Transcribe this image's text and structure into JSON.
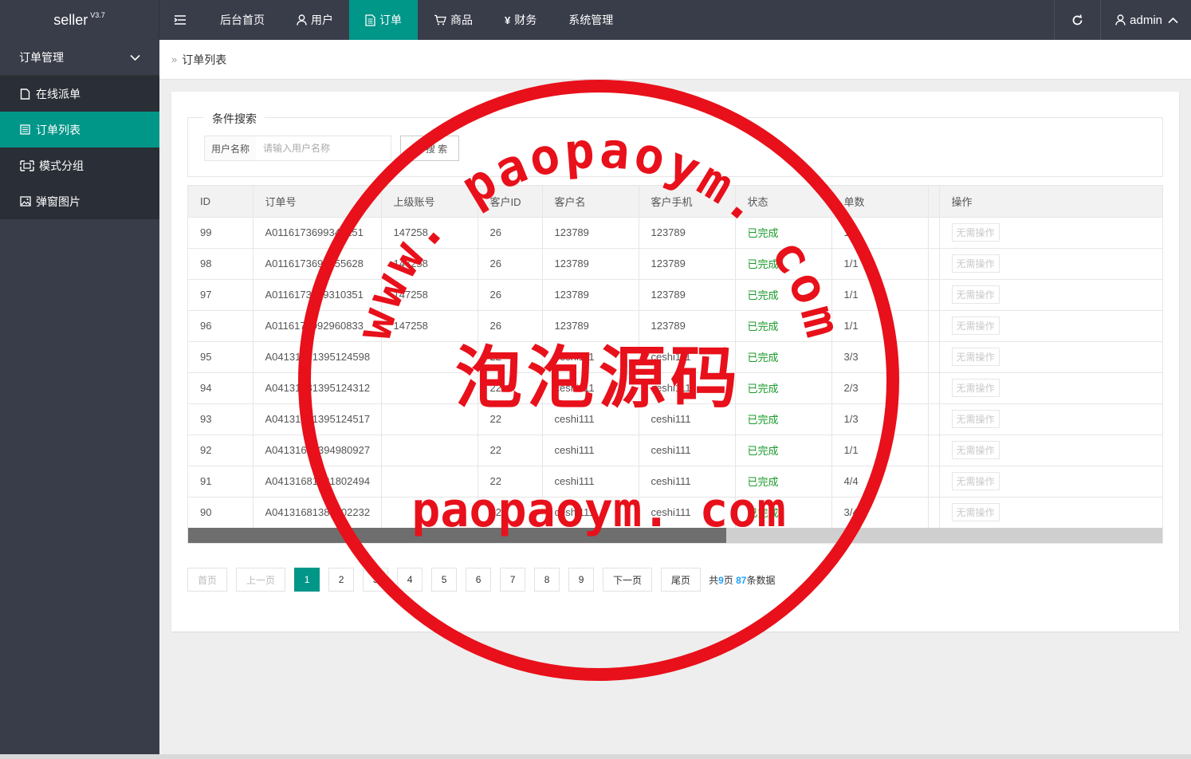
{
  "app": {
    "logo": "seller",
    "version": "V3.7"
  },
  "nav": {
    "items": [
      {
        "label": "后台首页",
        "icon": "",
        "active": false
      },
      {
        "label": "用户",
        "icon": "user-icon",
        "active": false
      },
      {
        "label": "订单",
        "icon": "document-icon",
        "active": true
      },
      {
        "label": "商品",
        "icon": "cart-icon",
        "active": false
      },
      {
        "label": "财务",
        "icon": "yen-icon",
        "active": false
      },
      {
        "label": "系统管理",
        "icon": "",
        "active": false
      }
    ],
    "user": "admin"
  },
  "sidebar": {
    "group": "订单管理",
    "items": [
      {
        "label": "在线派单",
        "icon": "file-icon",
        "active": false
      },
      {
        "label": "订单列表",
        "icon": "list-icon",
        "active": true
      },
      {
        "label": "模式分组",
        "icon": "group-icon",
        "active": false
      },
      {
        "label": "弹窗图片",
        "icon": "image-icon",
        "active": false
      }
    ]
  },
  "breadcrumb": {
    "sep": "»",
    "current": "订单列表"
  },
  "search": {
    "legend": "条件搜索",
    "label": "用户名称",
    "placeholder": "请输入用户名称",
    "value": "",
    "button": "搜 索"
  },
  "table": {
    "headers": [
      "ID",
      "订单号",
      "上级账号",
      "客户ID",
      "客户名",
      "客户手机",
      "状态",
      "单数",
      "",
      "操作"
    ],
    "rows": [
      [
        "99",
        "A0116173699340151",
        "147258",
        "26",
        "123789",
        "123789",
        "已完成",
        "1/1",
        "",
        "无需操作"
      ],
      [
        "98",
        "A0116173693155628",
        "147258",
        "26",
        "123789",
        "123789",
        "已完成",
        "1/1",
        "",
        "无需操作"
      ],
      [
        "97",
        "A0116173699310351",
        "147258",
        "26",
        "123789",
        "123789",
        "已完成",
        "1/1",
        "",
        "无需操作"
      ],
      [
        "96",
        "A0116175992960833",
        "147258",
        "26",
        "123789",
        "123789",
        "已完成",
        "1/1",
        "",
        "无需操作"
      ],
      [
        "95",
        "A04131681395124598",
        "",
        "22",
        "ceshi111",
        "ceshi111",
        "已完成",
        "3/3",
        "",
        "无需操作"
      ],
      [
        "94",
        "A04131681395124312",
        "",
        "22",
        "ceshi111",
        "ceshi111",
        "已完成",
        "2/3",
        "",
        "无需操作"
      ],
      [
        "93",
        "A04131681395124517",
        "",
        "22",
        "ceshi111",
        "ceshi111",
        "已完成",
        "1/3",
        "",
        "无需操作"
      ],
      [
        "92",
        "A04131681394980927",
        "",
        "22",
        "ceshi111",
        "ceshi111",
        "已完成",
        "1/1",
        "",
        "无需操作"
      ],
      [
        "91",
        "A04131681381802494",
        "",
        "22",
        "ceshi111",
        "ceshi111",
        "已完成",
        "4/4",
        "",
        "无需操作"
      ],
      [
        "90",
        "A04131681380802232",
        "",
        "22",
        "ceshi111",
        "ceshi111",
        "已完成",
        "3/4",
        "",
        "无需操作"
      ]
    ]
  },
  "pager": {
    "first": "首页",
    "prev": "上一页",
    "pages": [
      "1",
      "2",
      "3",
      "4",
      "5",
      "6",
      "7",
      "8",
      "9"
    ],
    "current": "1",
    "next": "下一页",
    "last": "尾页",
    "info_prefix": "共",
    "total_pages": "9",
    "info_mid": "页",
    "total_records": "87",
    "info_suffix": "条数据"
  },
  "watermark": {
    "arc_text": "www. paopaoym. com",
    "cn": "泡泡源码",
    "domain": "paopaoym. com",
    "color": "#e8101a"
  },
  "colors": {
    "accent": "#009688",
    "topbar": "#393d49",
    "status_done": "#1a9a2a"
  }
}
